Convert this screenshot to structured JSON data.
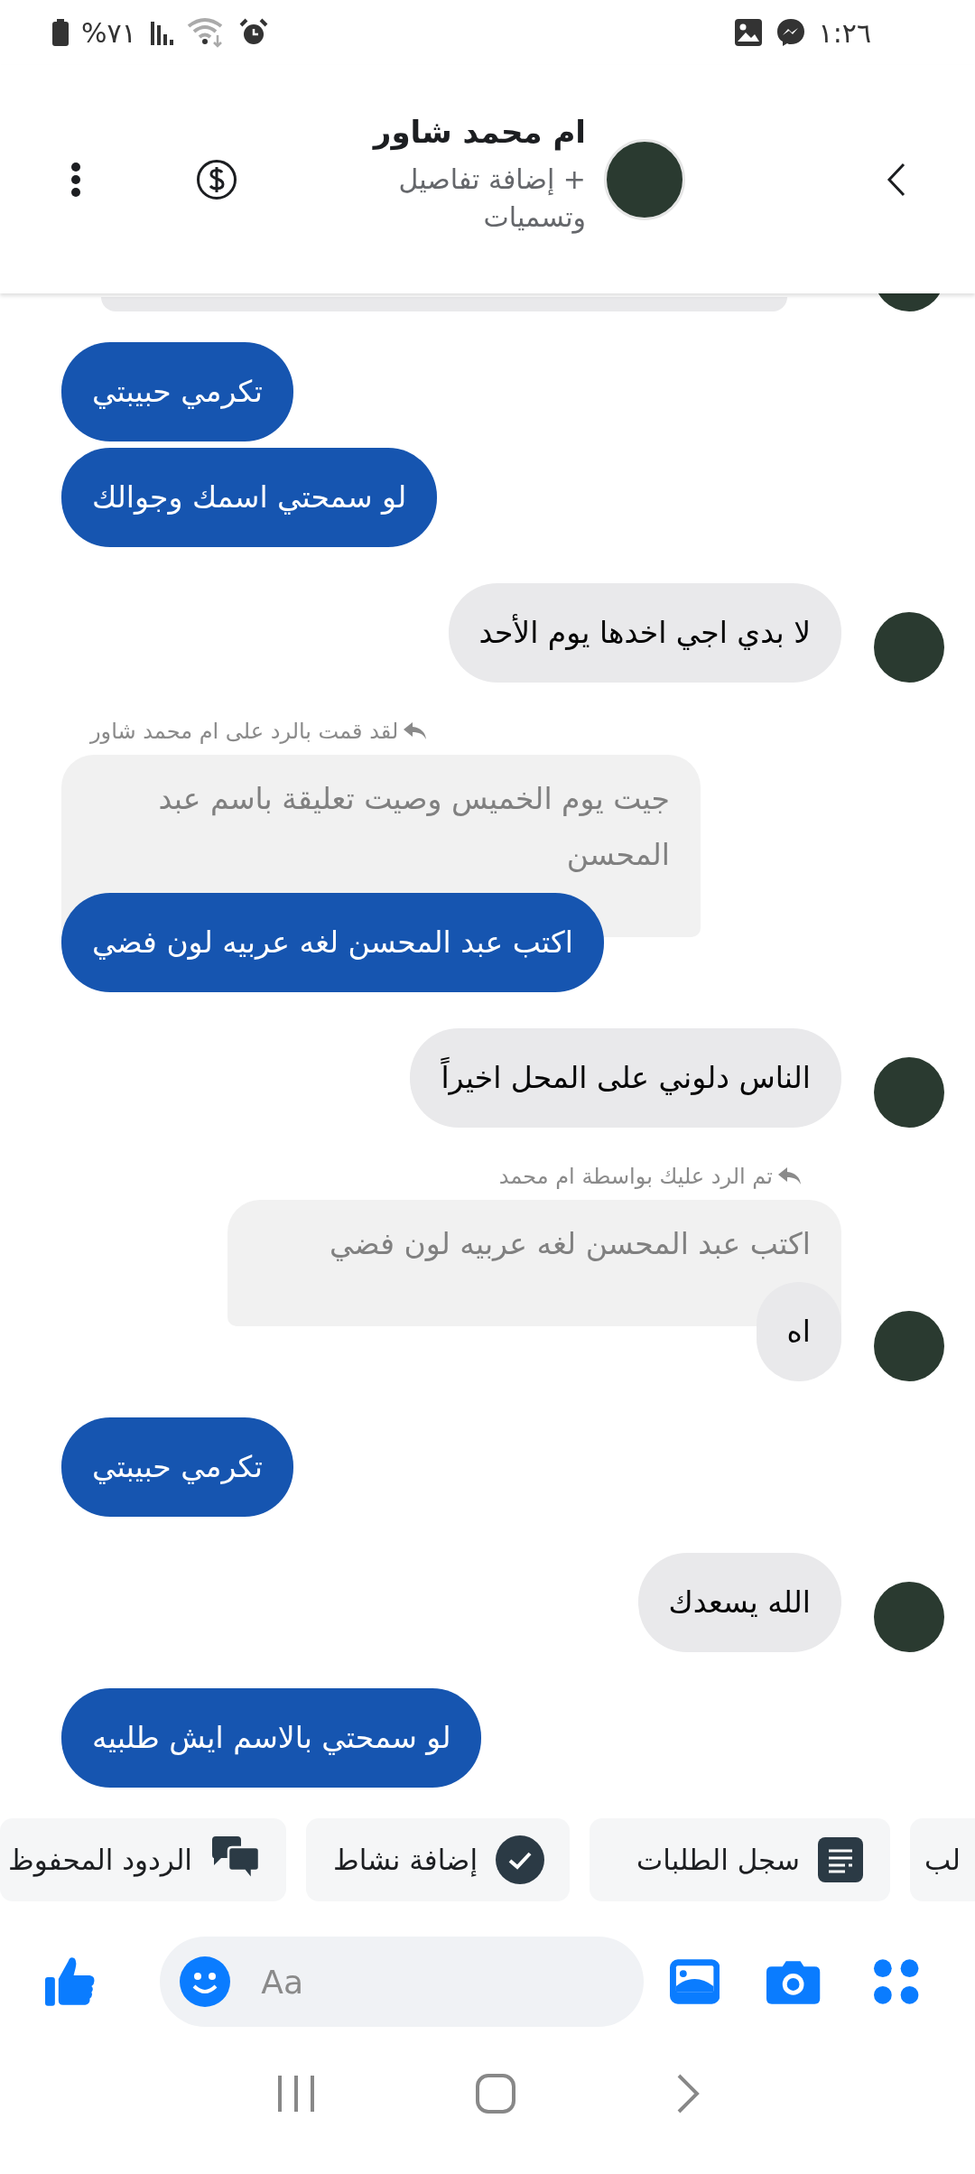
{
  "status_bar": {
    "battery": "%٧١",
    "time": "١:٢٦"
  },
  "header": {
    "title": "ام محمد شاور",
    "subtitle": "+ إضافة تفاصيل وتسميات"
  },
  "messages": [
    {
      "kind": "sent",
      "text": "تكرمي حبيبتي"
    },
    {
      "kind": "sent",
      "text": "لو سمحتي اسمك وجوالك"
    },
    {
      "kind": "received",
      "text": "لا بدي اجي اخدها يوم الأحد",
      "avatar": true
    },
    {
      "kind": "sent",
      "text": "اكتب عبد المحسن لغه عربيه لون فضي",
      "reply": {
        "label": "لقد قمت بالرد على ام محمد شاور",
        "quote": "جيت يوم الخميس وصيت تعليقة باسم عبد المحسن"
      }
    },
    {
      "kind": "received",
      "text": "الناس دلوني على المحل اخيراً",
      "avatar": true
    },
    {
      "kind": "received",
      "text": "اه",
      "avatar": true,
      "reply": {
        "label": "تم الرد عليك بواسطة ام محمد",
        "quote": "اكتب عبد المحسن لغه عربيه لون فضي"
      }
    },
    {
      "kind": "sent",
      "text": "تكرمي حبيبتي"
    },
    {
      "kind": "received",
      "text": "الله يسعدك",
      "avatar": true
    },
    {
      "kind": "sent",
      "text": "لو سمحتي بالاسم ايش طلبيه"
    }
  ],
  "quick_replies": [
    {
      "kind": "partial",
      "label": "لب"
    },
    {
      "kind": "list",
      "label": "سجل الطلبات"
    },
    {
      "kind": "check",
      "label": "إضافة نشاط"
    },
    {
      "kind": "chat",
      "label": "الردود المحفوظ"
    }
  ],
  "composer": {
    "placeholder": "Aa"
  }
}
